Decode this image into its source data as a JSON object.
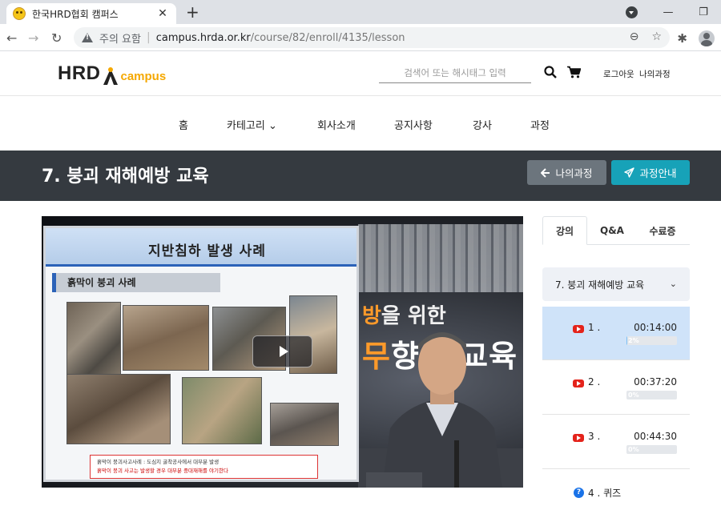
{
  "browser": {
    "tab_title": "한국HRD협회 캠퍼스",
    "tab_close": "✕",
    "new_tab": "+",
    "security_label": "주의 요함",
    "url_host": "campus.hrda.or.kr",
    "url_path": "/course/82/enroll/4135/lesson",
    "window_buttons": [
      "—",
      "❐"
    ]
  },
  "header": {
    "logo_main": "HRD",
    "logo_sub": "campus",
    "search_placeholder": "검색어 또는 해시태그 입력",
    "logout": "로그아웃",
    "my_courses": "나의과정"
  },
  "nav": {
    "items": [
      "홈",
      "카테고리 ⌄",
      "회사소개",
      "공지사항",
      "강사",
      "과정"
    ]
  },
  "title_band": {
    "title": "7. 붕괴 재해예방 교육",
    "back_button": "나의과정",
    "guide_button": "과정안내"
  },
  "video": {
    "slide_title": "지반침하 발생 사례",
    "slide_subtitle": "흙막이 붕괴 사례",
    "slide_note_1": "흙막이 붕괴사고사례 : 도심지 굴착공사에서 대부분 발생",
    "slide_note_2": "흙막이 붕괴 사고는 발생할 경우 대부분 중대재해를 야기한다",
    "bg_text_1_orange": "방",
    "bg_text_1": "을 위한",
    "bg_text_2_orange": "무",
    "bg_text_2": "향상 교육"
  },
  "panel": {
    "tabs": [
      "강의",
      "Q&A",
      "수료증"
    ],
    "chapter": "7. 붕괴 재해예방 교육",
    "lessons": [
      {
        "no": "1 .",
        "duration": "00:14:00",
        "progress_label": "2%",
        "progress": 2
      },
      {
        "no": "2 .",
        "duration": "00:37:20",
        "progress_label": "0%",
        "progress": 0
      },
      {
        "no": "3 .",
        "duration": "00:44:30",
        "progress_label": "0%",
        "progress": 0
      }
    ],
    "quiz_label": "4 . 퀴즈",
    "quiz_icon": "?"
  },
  "colors": {
    "title_band": "#353a40",
    "accent_teal": "#17a2b8",
    "accent_gray": "#6c757d",
    "active_lesson": "#cfe3f9",
    "logo_orange": "#f5a800"
  }
}
